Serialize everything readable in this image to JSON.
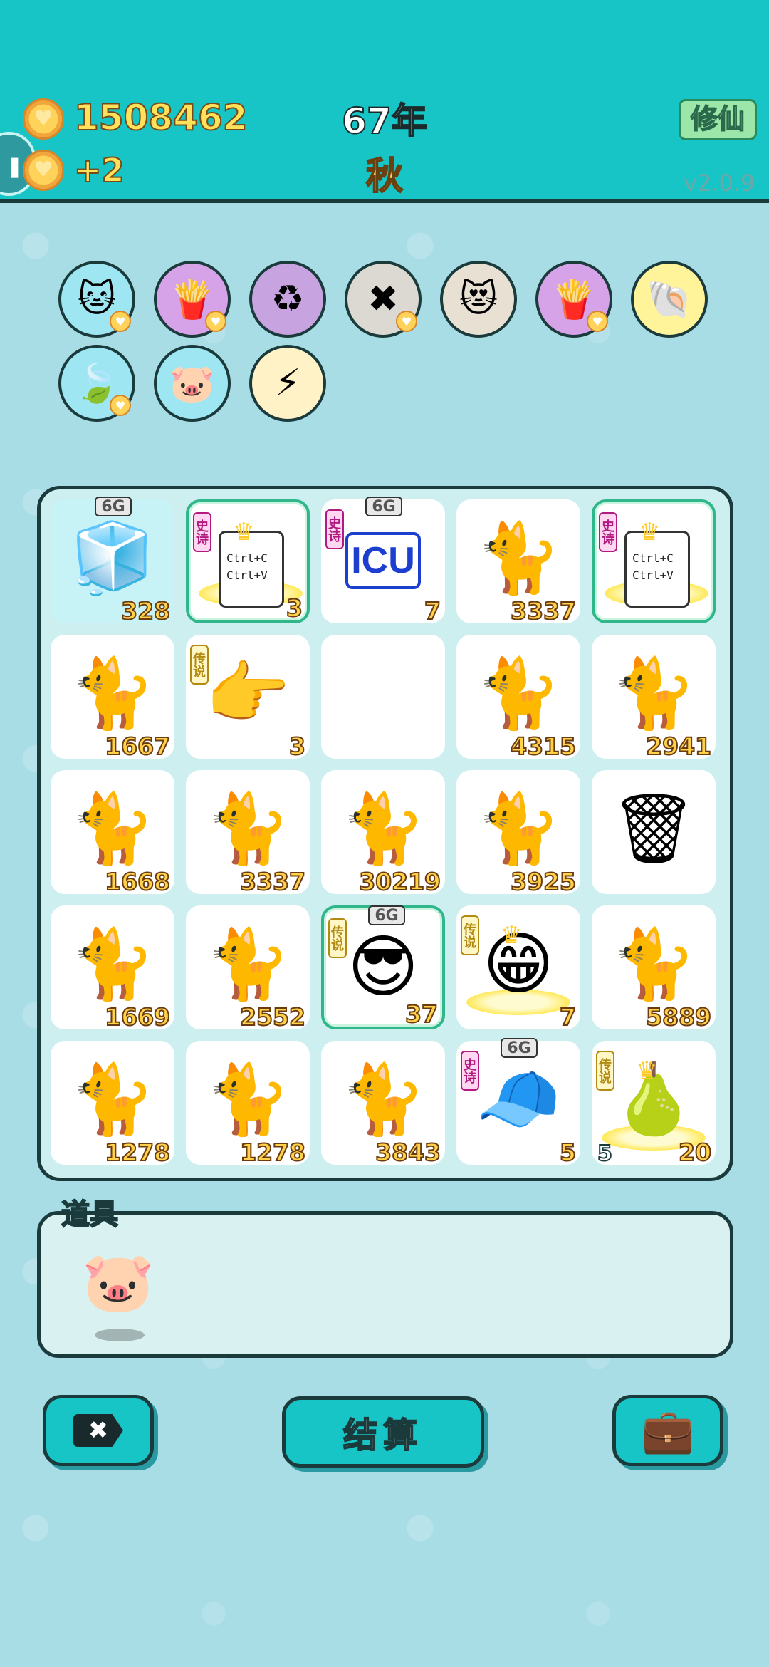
{
  "header": {
    "coins": "1508462",
    "income": "+2",
    "year": "67年",
    "season": "秋",
    "mode_button": "修仙",
    "version": "v2.0.9"
  },
  "buffs": [
    {
      "icon": "cat-face-icon",
      "glyph": "🐱",
      "bg": "#9ee6f2",
      "coin": true
    },
    {
      "icon": "fries-icon",
      "glyph": "🍟",
      "bg": "#d7a3e8",
      "coin": true
    },
    {
      "icon": "recycle-icon",
      "glyph": "♻",
      "bg": "#c7a3e0",
      "coin": false
    },
    {
      "icon": "close-tag-icon",
      "glyph": "✖",
      "bg": "#dcd9d2",
      "coin": true
    },
    {
      "icon": "cats-hearts-icon",
      "glyph": "😻",
      "bg": "#e8e0d3",
      "coin": false
    },
    {
      "icon": "fries-icon",
      "glyph": "🍟",
      "bg": "#d7a3e8",
      "coin": true
    },
    {
      "icon": "shell-icon",
      "glyph": "🐚",
      "bg": "#fff49a",
      "coin": false
    },
    {
      "icon": "leaf-icon",
      "glyph": "🍃",
      "bg": "#9ee6f2",
      "coin": true
    },
    {
      "icon": "piggy-bank-icon",
      "glyph": "🐷",
      "bg": "#9ee6f2",
      "coin": false
    },
    {
      "icon": "lightning-icon",
      "glyph": "⚡",
      "bg": "#fff2c6",
      "coin": false
    }
  ],
  "board": [
    {
      "item": "fridge-icon",
      "glyph": "🧊",
      "count": "328",
      "sixg": "6G",
      "style": "bg-cyan"
    },
    {
      "item": "copy-paste-card-icon",
      "glyph": "",
      "count": "3",
      "tag": "史诗",
      "tagType": "epic",
      "frame": true,
      "crown": true,
      "halo": true,
      "copy": [
        "Ctrl+C",
        "Ctrl+V"
      ]
    },
    {
      "item": "icu-sign-icon",
      "glyph": "",
      "count": "7",
      "tag": "史诗",
      "tagType": "epic",
      "sixg": "6G",
      "icu": "ICU"
    },
    {
      "item": "cat-icon",
      "glyph": "🐈",
      "count": "3337"
    },
    {
      "item": "copy-paste-card-icon",
      "glyph": "",
      "count": "",
      "tag": "史诗",
      "tagType": "epic",
      "frame": true,
      "crown": true,
      "halo": true,
      "copy": [
        "Ctrl+C",
        "Ctrl+V"
      ]
    },
    {
      "item": "cat-icon",
      "glyph": "🐈",
      "count": "1667"
    },
    {
      "item": "pointing-hand-icon",
      "glyph": "👉",
      "count": "3",
      "tag": "传说",
      "tagType": "legend"
    },
    {
      "item": "empty-cell",
      "glyph": "",
      "count": ""
    },
    {
      "item": "cat-icon",
      "glyph": "🐈",
      "count": "4315"
    },
    {
      "item": "cat-icon",
      "glyph": "🐈",
      "count": "2941"
    },
    {
      "item": "cat-icon",
      "glyph": "🐈",
      "count": "1668"
    },
    {
      "item": "cat-icon",
      "glyph": "🐈",
      "count": "3337"
    },
    {
      "item": "cat-icon",
      "glyph": "🐈",
      "count": "30219"
    },
    {
      "item": "cat-icon",
      "glyph": "🐈",
      "count": "3925"
    },
    {
      "item": "garbage-bag-icon",
      "glyph": "🗑",
      "count": ""
    },
    {
      "item": "cat-icon",
      "glyph": "🐈",
      "count": "1669"
    },
    {
      "item": "cat-icon",
      "glyph": "🐈",
      "count": "2552"
    },
    {
      "item": "sunglasses-man-icon",
      "glyph": "😎",
      "count": "37",
      "tag": "传说",
      "tagType": "legend",
      "sixg": "6G",
      "frame": true
    },
    {
      "item": "crowned-old-man-icon",
      "glyph": "😁",
      "count": "7",
      "tag": "传说",
      "tagType": "legend",
      "crown": true,
      "halo": true
    },
    {
      "item": "cat-icon",
      "glyph": "🐈",
      "count": "5889"
    },
    {
      "item": "cat-icon",
      "glyph": "🐈",
      "count": "1278"
    },
    {
      "item": "cat-icon",
      "glyph": "🐈",
      "count": "1278"
    },
    {
      "item": "cat-icon",
      "glyph": "🐈",
      "count": "3843"
    },
    {
      "item": "red-cap-boy-icon",
      "glyph": "🧢",
      "count": "5",
      "tag": "史诗",
      "tagType": "epic",
      "sixg": "6G"
    },
    {
      "item": "golden-pear-icon",
      "glyph": "🍐",
      "count": "20",
      "leftCount": "5",
      "tag": "传说",
      "tagType": "legend",
      "crown": true,
      "halo": true
    }
  ],
  "props": {
    "label": "道具",
    "items": [
      {
        "icon": "piggy-bank-icon",
        "glyph": "🐷"
      }
    ]
  },
  "buttons": {
    "remove": "✖",
    "settle": "结算",
    "bag": "💼"
  },
  "colors": {
    "header_bg": "#17c4c6",
    "page_bg": "#a9dde6",
    "count_text": "#ffd24a",
    "epic_tag": "#b21a82",
    "legend_tag": "#b28a10"
  }
}
